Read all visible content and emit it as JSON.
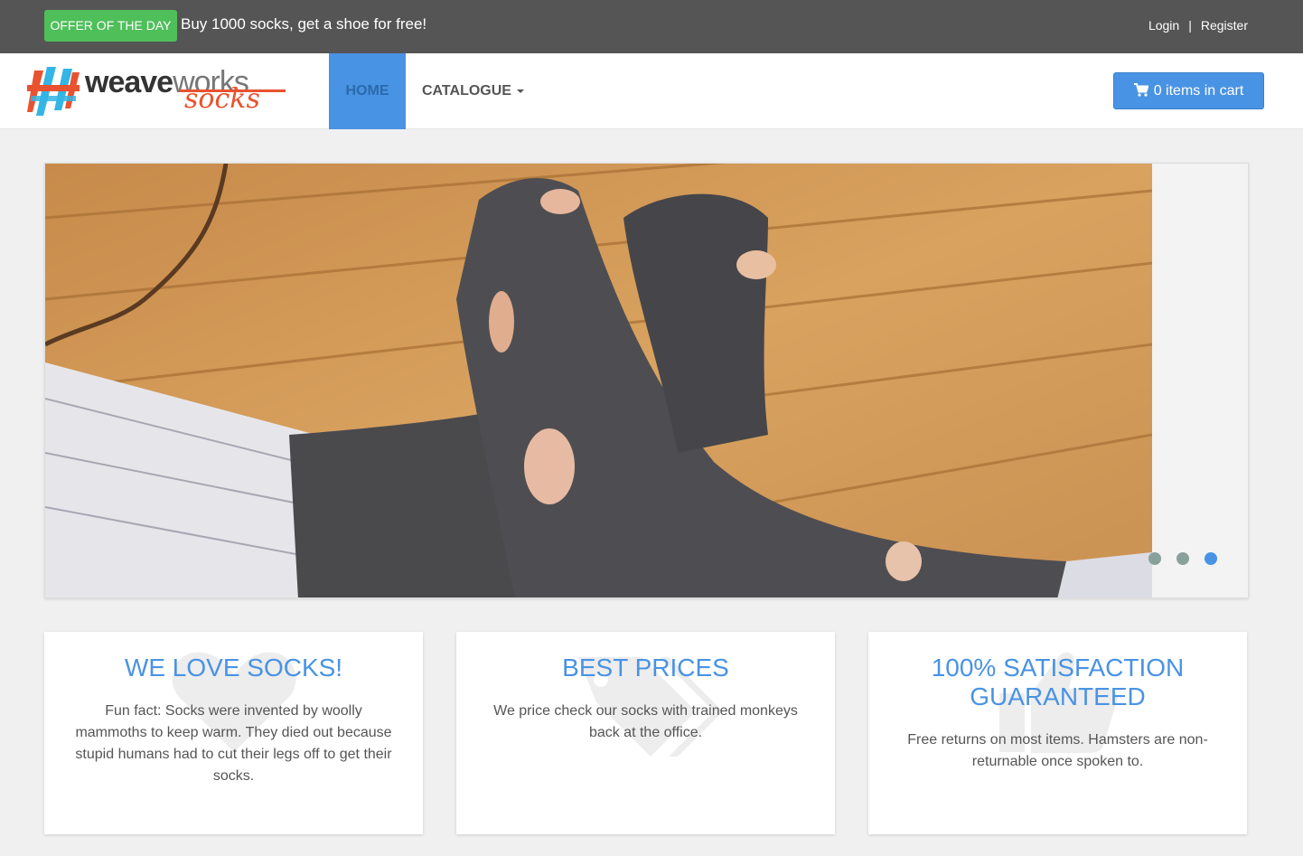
{
  "topbar": {
    "offer_badge": "OFFER OF THE DAY",
    "offer_text": "Buy 1000 socks, get a shoe for free!",
    "login": "Login",
    "separator": "|",
    "register": "Register"
  },
  "logo": {
    "word_bold": "weave",
    "word_gray": "works",
    "word_script": "socks"
  },
  "nav": {
    "home": "HOME",
    "catalogue": "CATALOGUE"
  },
  "cart": {
    "label": "0 items in cart",
    "icon": "shopping-cart-icon"
  },
  "carousel": {
    "slide_count": 3,
    "active_index": 2
  },
  "features": [
    {
      "title": "WE LOVE SOCKS!",
      "text": "Fun fact: Socks were invented by woolly mammoths to keep warm. They died out because stupid humans had to cut their legs off to get their socks.",
      "icon": "heart-icon"
    },
    {
      "title": "BEST PRICES",
      "text": "We price check our socks with trained monkeys back at the office.",
      "icon": "tags-icon"
    },
    {
      "title": "100% SATISFACTION GUARANTEED",
      "text": "Free returns on most items. Hamsters are non-returnable once spoken to.",
      "icon": "thumbs-up-icon"
    }
  ],
  "colors": {
    "accent": "#4993e4",
    "offer_green": "#4fbf5a",
    "topbar": "#555555",
    "logo_orange": "#e8522f"
  }
}
